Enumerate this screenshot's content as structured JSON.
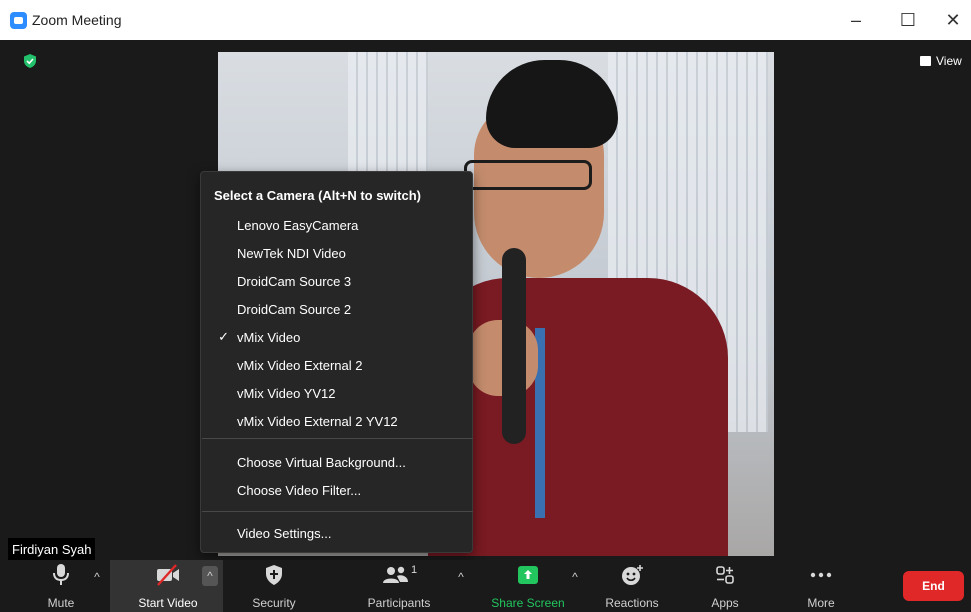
{
  "window": {
    "title": "Zoom Meeting",
    "minimize_label": "–",
    "maximize_label": "☐",
    "close_label": "✕"
  },
  "meeting": {
    "view_label": "View",
    "participant_name": "Firdiyan Syah"
  },
  "camera_menu": {
    "title": "Select a Camera (Alt+N to switch)",
    "cameras": [
      {
        "label": "Lenovo EasyCamera",
        "checked": false
      },
      {
        "label": "NewTek NDI Video",
        "checked": false
      },
      {
        "label": "DroidCam Source 3",
        "checked": false
      },
      {
        "label": "DroidCam Source 2",
        "checked": false
      },
      {
        "label": "vMix Video",
        "checked": true
      },
      {
        "label": "vMix Video External 2",
        "checked": false
      },
      {
        "label": "vMix Video YV12",
        "checked": false
      },
      {
        "label": "vMix Video External 2 YV12",
        "checked": false
      }
    ],
    "check_glyph": "✓",
    "background_options": [
      "Choose Virtual Background...",
      "Choose Video Filter..."
    ],
    "settings_label": "Video Settings..."
  },
  "toolbar": {
    "mute_label": "Mute",
    "start_video_label": "Start Video",
    "security_label": "Security",
    "participants_label": "Participants",
    "participants_count": "1",
    "share_screen_label": "Share Screen",
    "reactions_label": "Reactions",
    "apps_label": "Apps",
    "more_label": "More",
    "end_label": "End",
    "caret_glyph": "^"
  },
  "colors": {
    "accent": "#2d8cff",
    "share_green": "#22c55e",
    "end_red": "#e02828",
    "shield_green": "#23c16b"
  }
}
